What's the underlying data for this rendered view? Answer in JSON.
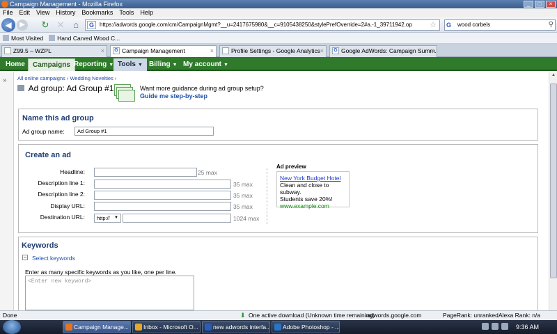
{
  "browser": {
    "window_title": "Campaign Management - Mozilla Firefox",
    "menu": [
      "File",
      "Edit",
      "View",
      "History",
      "Bookmarks",
      "Tools",
      "Help"
    ],
    "url": "https://adwords.google.com/cm/CampaignMgmt?__u=2417675980&__c=9105438250&stylePrefOverride=2#a.-1_39711942.op",
    "search_value": "wood corbels",
    "bookmarks": [
      "Most Visited",
      "Hand Carved Wood C..."
    ],
    "tabs": [
      {
        "label": "Z99.5 – WZPL",
        "active": false
      },
      {
        "label": "Campaign Management",
        "active": true
      },
      {
        "label": "Profile Settings - Google Analytics",
        "active": false
      },
      {
        "label": "Google AdWords: Campaign Summ...",
        "active": false
      }
    ]
  },
  "adwords_nav": {
    "items": [
      "Home",
      "Campaigns",
      "Reporting",
      "Tools",
      "Billing",
      "My account"
    ]
  },
  "page": {
    "breadcrumb": "All online campaigns › Wedding Novelties ›",
    "heading_prefix": "Ad group:",
    "heading_name": "Ad Group #1",
    "guide_question": "Want more guidance during ad group setup?",
    "guide_link": "Guide me step-by-step"
  },
  "name_section": {
    "title": "Name this ad group",
    "label": "Ad group name:",
    "value": "Ad Group #1"
  },
  "ad_section": {
    "title": "Create an ad",
    "fields": [
      {
        "label": "Headline:",
        "max": "25 max"
      },
      {
        "label": "Description line 1:",
        "max": "35 max"
      },
      {
        "label": "Description line 2:",
        "max": "35 max"
      },
      {
        "label": "Display URL:",
        "max": "35 max"
      },
      {
        "label": "Destination URL:",
        "max": "1024 max"
      }
    ],
    "protocol": "http://",
    "preview_title": "Ad preview",
    "preview_headline": "New York Budget Hotel",
    "preview_line1": "Clean and close to subway.",
    "preview_line2": "Students save 20%!",
    "preview_url": "www.example.com"
  },
  "keywords_section": {
    "title": "Keywords",
    "select_link": "Select keywords",
    "instructions": "Enter as many specific keywords as you like, one per line.",
    "placeholder": "<Enter new keyword>"
  },
  "statusbar": {
    "left": "Done",
    "download": "One active download (Unknown time remaining)",
    "domain": "adwords.google.com",
    "pagerank": "PageRank: unranked",
    "alexa": "Alexa Rank: n/a"
  },
  "taskbar": {
    "tasks": [
      {
        "label": "Campaign Manage...",
        "active": true,
        "color": "#e8751a"
      },
      {
        "label": "Inbox - Microsoft O...",
        "active": false,
        "color": "#e6a72a"
      },
      {
        "label": "new adwords interfa...",
        "active": false,
        "color": "#2a5bb7"
      },
      {
        "label": "Adobe Photoshop - ...",
        "active": false,
        "color": "#2a74c2"
      }
    ],
    "clock": "9:36 AM"
  }
}
